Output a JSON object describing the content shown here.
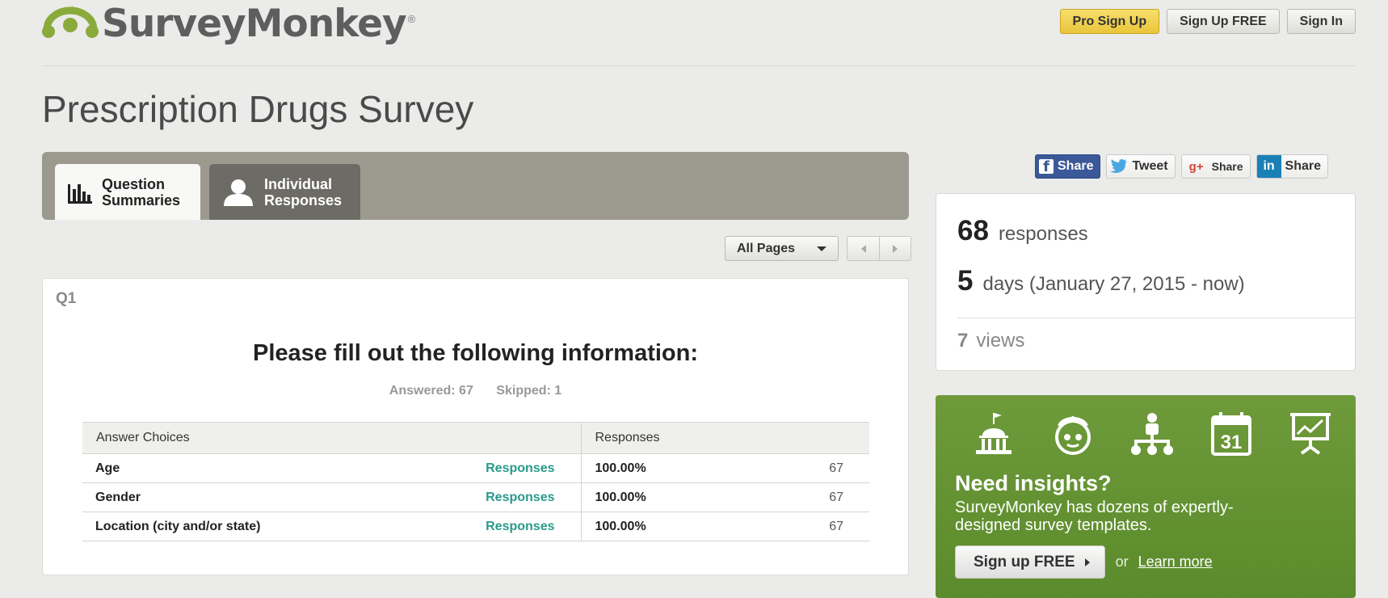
{
  "header": {
    "logo_text": "SurveyMonkey",
    "logo_reg": "®",
    "buttons": {
      "pro_signup": "Pro Sign Up",
      "signup_free": "Sign Up FREE",
      "sign_in": "Sign In"
    }
  },
  "page_title": "Prescription Drugs Survey",
  "tabs": [
    {
      "line1": "Question",
      "line2": "Summaries",
      "active": true
    },
    {
      "line1": "Individual",
      "line2": "Responses",
      "active": false
    }
  ],
  "pager": {
    "selected": "All Pages"
  },
  "question": {
    "number": "Q1",
    "title": "Please fill out the following information:",
    "answered": "Answered: 67",
    "skipped": "Skipped: 1",
    "table": {
      "headers": [
        "Answer Choices",
        "Responses"
      ],
      "link_label": "Responses",
      "rows": [
        {
          "choice": "Age",
          "percent": "100.00%",
          "count": "67"
        },
        {
          "choice": "Gender",
          "percent": "100.00%",
          "count": "67"
        },
        {
          "choice": "Location (city and/or state)",
          "percent": "100.00%",
          "count": "67"
        }
      ]
    }
  },
  "share": {
    "facebook": "Share",
    "twitter": "Tweet",
    "google": "Share",
    "linkedin": "Share"
  },
  "stats": {
    "responses_num": "68",
    "responses_lbl": "responses",
    "days_num": "5",
    "days_lbl": "days (January 27, 2015 - now)",
    "views_num": "7",
    "views_lbl": "views"
  },
  "insights": {
    "title": "Need insights?",
    "text": "SurveyMonkey has dozens of expertly-designed survey templates.",
    "signup": "Sign up FREE",
    "or": "or",
    "learn": "Learn more",
    "calendar_day": "31"
  },
  "colors": {
    "pro_button": "#e9c53a",
    "accent_link": "#2a9a8c",
    "insights_green": "#6e9a3a",
    "facebook": "#3b5998",
    "logo_green": "#8aab3c"
  }
}
